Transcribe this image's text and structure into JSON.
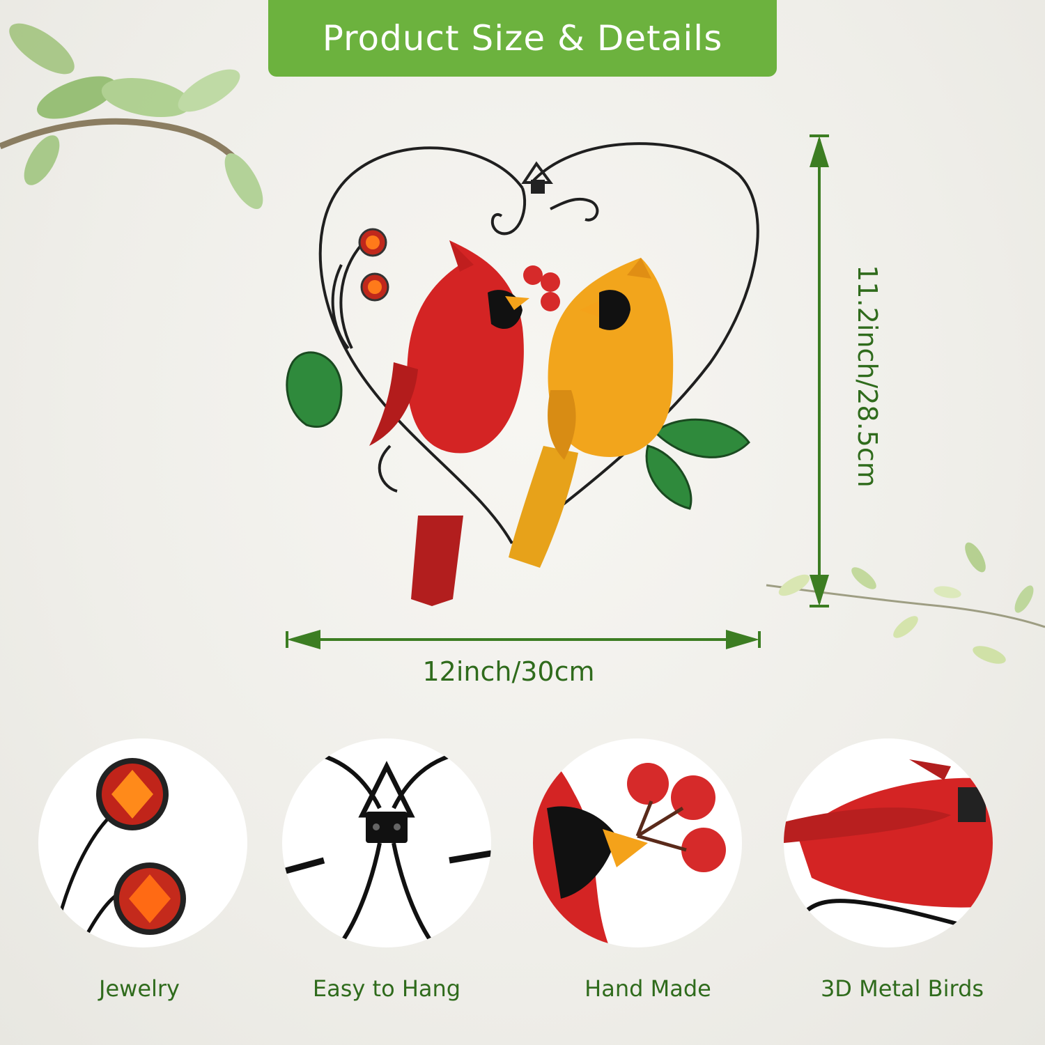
{
  "banner": {
    "title": "Product Size & Details"
  },
  "dimensions": {
    "width_label": "12inch/30cm",
    "height_label": "11.2inch/28.5cm"
  },
  "features": [
    {
      "label": "Jewelry",
      "icon": "jewel-icon"
    },
    {
      "label": "Easy to Hang",
      "icon": "hanger-hook-icon"
    },
    {
      "label": "Hand Made",
      "icon": "bird-beak-berries-icon"
    },
    {
      "label": "3D Metal Birds",
      "icon": "metal-bird-icon"
    }
  ],
  "colors": {
    "accent_green": "#6cb23e",
    "label_green": "#2f6b1c",
    "cardinal_red": "#d42424",
    "cardinal_yellow": "#f2a51c",
    "leaf_green": "#2f8a3c"
  }
}
